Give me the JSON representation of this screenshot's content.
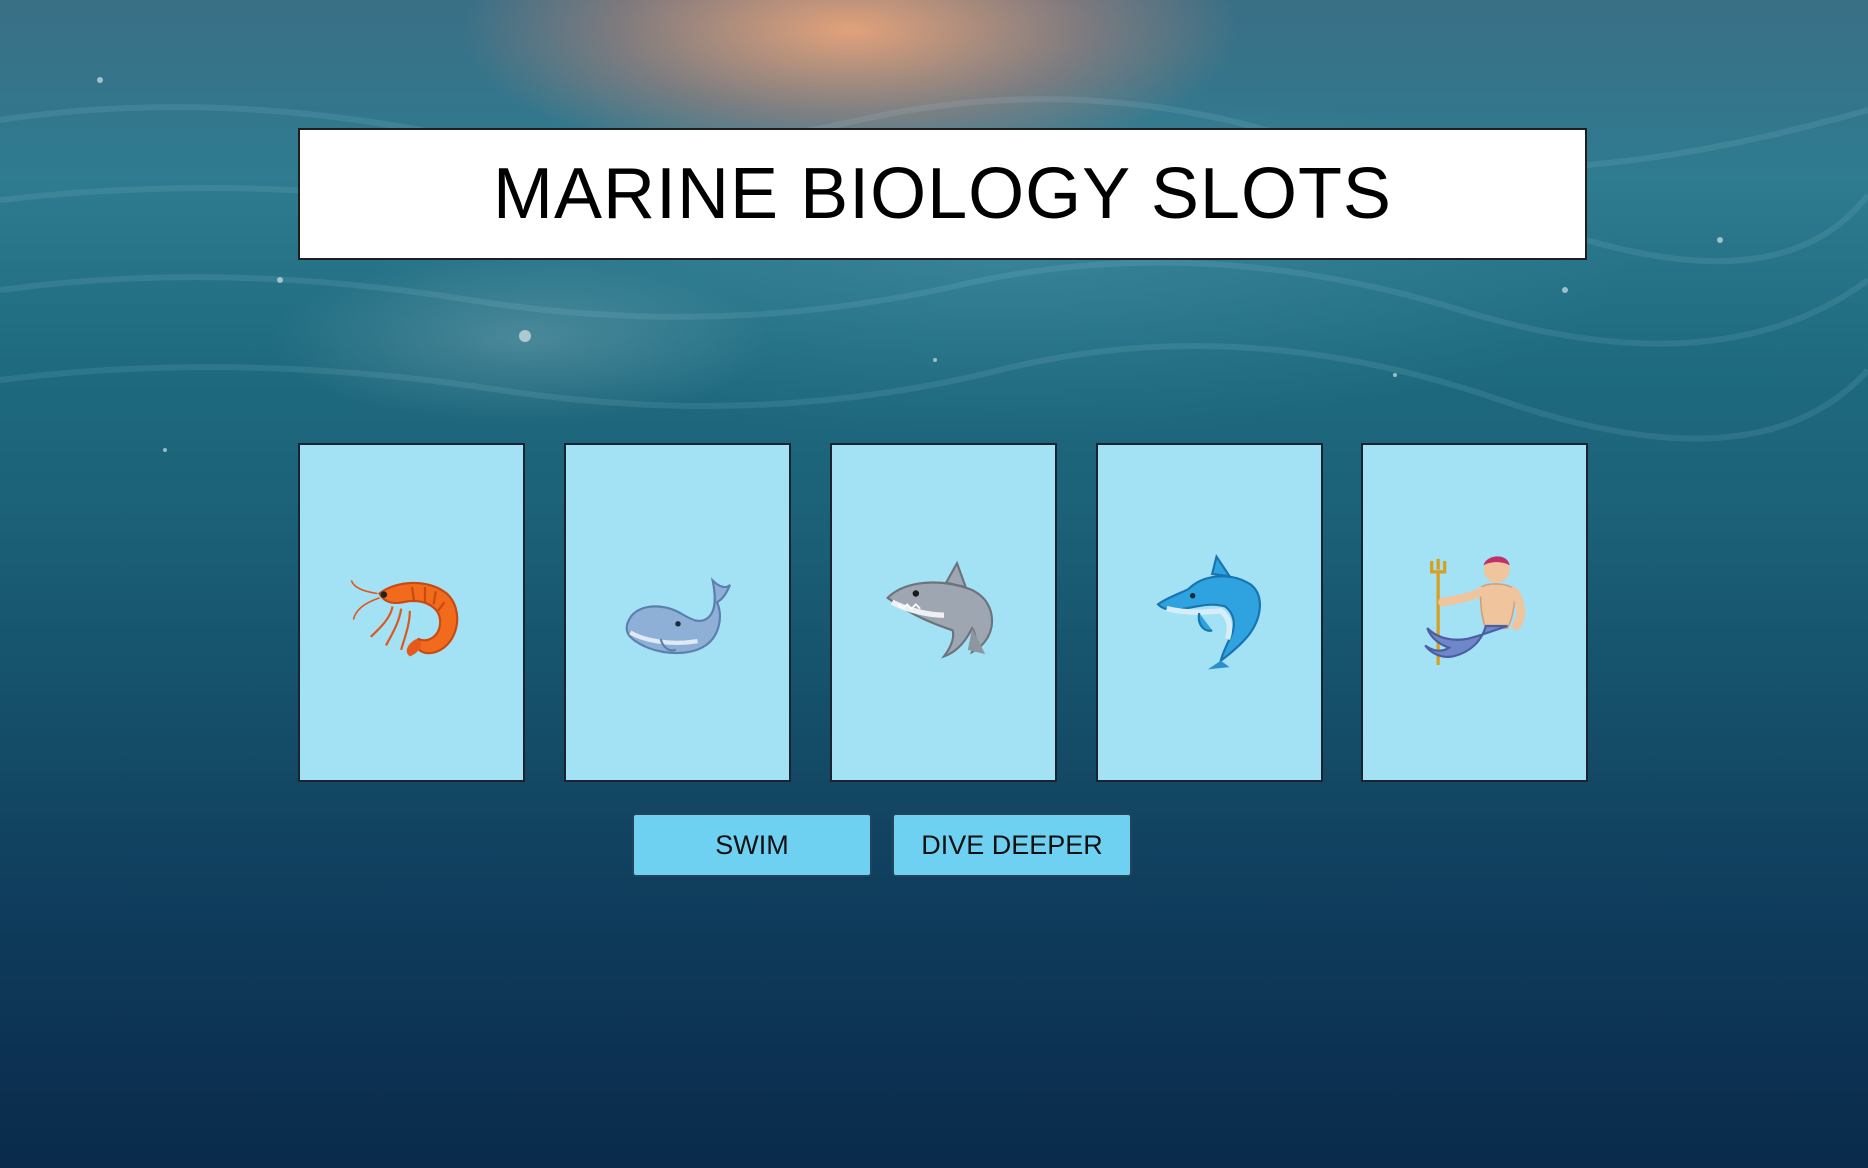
{
  "title": "MARINE BIOLOGY SLOTS",
  "reels": [
    {
      "symbol": "shrimp-icon"
    },
    {
      "symbol": "whale-icon"
    },
    {
      "symbol": "shark-icon"
    },
    {
      "symbol": "dolphin-icon"
    },
    {
      "symbol": "merman-icon"
    }
  ],
  "buttons": {
    "swim": "SWIM",
    "dive_deeper": "DIVE DEEPER"
  },
  "colors": {
    "reel_background": "#a3e1f5",
    "button_background": "#6ed1f2",
    "title_background": "#ffffff"
  }
}
